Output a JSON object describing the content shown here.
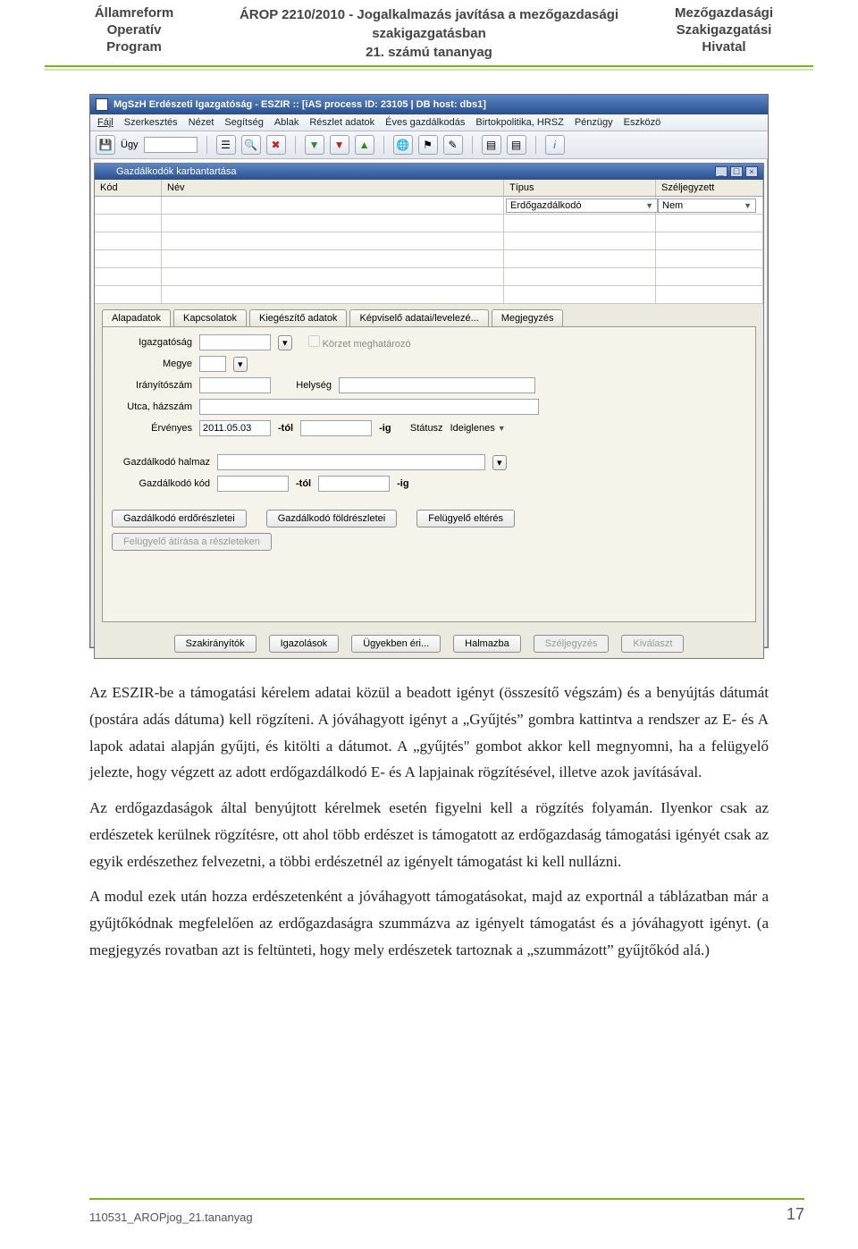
{
  "header": {
    "left_line1": "Államreform",
    "left_line2": "Operatív",
    "left_line3": "Program",
    "center_line1": "ÁROP 2210/2010 - Jogalkalmazás javítása a mezőgazdasági",
    "center_line2": "szakigazgatásban",
    "center_line3": "21. számú tananyag",
    "right_line1": "Mezőgazdasági",
    "right_line2": "Szakigazgatási",
    "right_line3": "Hivatal"
  },
  "app": {
    "title": "MgSzH Erdészeti Igazgatóság - ESZIR :: [iAS process ID: 23105 | DB host: dbs1]",
    "menu": [
      "Fájl",
      "Szerkesztés",
      "Nézet",
      "Segítség",
      "Ablak",
      "Részlet adatok",
      "Éves gazdálkodás",
      "Birtokpolitika, HRSZ",
      "Pénzügy",
      "Eszközö"
    ],
    "toolbar_user_label": "Ügy",
    "subwin_title": "Gazdálkodók karbantartása",
    "grid": {
      "headers": {
        "kod": "Kód",
        "nev": "Név",
        "tipus": "Típus",
        "szj": "Széljegyzett"
      },
      "row0": {
        "tipus": "Erdőgazdálkodó",
        "szj": "Nem"
      }
    },
    "tabs": [
      "Alapadatok",
      "Kapcsolatok",
      "Kiegészítő adatok",
      "Képviselő adatai/levelezé...",
      "Megjegyzés"
    ],
    "labels": {
      "igazg": "Igazgatóság",
      "korzet": "Körzet meghatározó",
      "megye": "Megye",
      "irsz": "Irányítószám",
      "helyseg": "Helység",
      "utca": "Utca, házszám",
      "ervenyes": "Érvényes",
      "date_val": "2011.05.03",
      "tol": "-tól",
      "ig": "-ig",
      "statusz": "Státusz",
      "statusz_val": "Ideiglenes",
      "halmaz": "Gazdálkodó halmaz",
      "gkod": "Gazdálkodó kód"
    },
    "panel_buttons": {
      "erdoreszletei": "Gazdálkodó erdőrészletei",
      "foldreszletei": "Gazdálkodó földrészletei",
      "felugy_elteres": "Felügyelő eltérés",
      "felugy_atirasa": "Felügyelő átírása a részleteken"
    },
    "bottom_buttons": [
      "Szakirányítók",
      "Igazolások",
      "Ügyekben éri...",
      "Halmazba",
      "Széljegyzés",
      "Kiválaszt"
    ]
  },
  "paragraphs": {
    "p1": "Az ESZIR-be a támogatási kérelem adatai közül a beadott igényt (összesítő végszám) és a benyújtás dátumát (postára adás dátuma) kell rögzíteni. A jóváhagyott igényt a „Gyűjtés” gombra kattintva a rendszer az E- és A lapok adatai alapján gyűjti, és kitölti a dátumot. A „gyűjtés\" gombot akkor kell megnyomni, ha a felügyelő jelezte, hogy végzett az adott erdőgazdálkodó E- és A lapjainak rögzítésével, illetve azok javításával.",
    "p2": "Az erdőgazdaságok által benyújtott kérelmek esetén figyelni kell a rögzítés folyamán. Ilyenkor csak az erdészetek kerülnek rögzítésre, ott ahol több erdészet is támogatott az erdőgazdaság támogatási igényét csak az egyik erdészethez felvezetni, a többi erdészetnél az igényelt támogatást ki kell nullázni.",
    "p3": "A modul ezek után hozza erdészetenként a jóváhagyott támogatásokat, majd az exportnál a táblázatban már a gyűjtőkódnak megfelelően az erdőgazdaságra szummázva az igényelt támogatást és a jóváhagyott igényt. (a megjegyzés rovatban azt is feltünteti, hogy mely erdészetek tartoznak a „szummázott” gyűjtőkód alá.)"
  },
  "footer": {
    "file": "110531_AROPjog_21.tananyag",
    "page": "17"
  }
}
